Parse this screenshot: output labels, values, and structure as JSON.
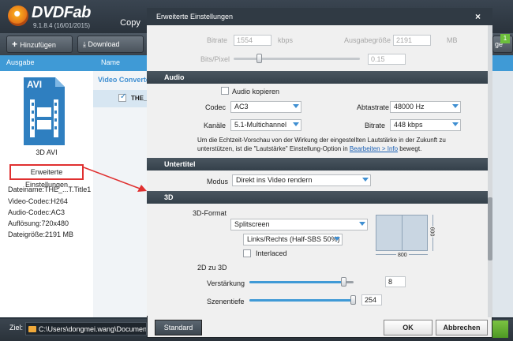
{
  "app": {
    "name": "DVDFab",
    "version": "9.1.8.4 (16/01/2015)",
    "tab": "Copy"
  },
  "toolbar": {
    "add": "Hinzufügen",
    "download": "Download",
    "right_partial": "ge",
    "badge": "1"
  },
  "columns": {
    "output": "Ausgabe",
    "name": "Name"
  },
  "main": {
    "converter": "Video Converter",
    "title_item": "THE_"
  },
  "left": {
    "format_badge": "AVI",
    "format_label": "3D AVI",
    "advanced_button": "Erweiterte Einstellungen",
    "info": [
      "Dateiname:THE_...T.Title1",
      "Video-Codec:H264",
      "Audio-Codec:AC3",
      "Auflösung:720x480",
      "Dateigröße:2191 MB"
    ]
  },
  "bottom": {
    "ziel_label": "Ziel:",
    "path": "C:\\Users\\dongmei.wang\\Documents\\D"
  },
  "dialog": {
    "title": "Erweiterte Einstellungen",
    "close": "×",
    "video": {
      "bitrate_label": "Bitrate",
      "bitrate_value": "1554",
      "bitrate_unit": "kbps",
      "size_label": "Ausgabegröße",
      "size_value": "2191",
      "size_unit": "MB",
      "bpp_label": "Bits/Pixel",
      "bpp_value": "0.15",
      "bpp_level": 0.2
    },
    "audio": {
      "section": "Audio",
      "copy_label": "Audio kopieren",
      "codec_label": "Codec",
      "codec_value": "AC3",
      "rate_label": "Abtastrate",
      "rate_value": "48000 Hz",
      "channels_label": "Kanäle",
      "channels_value": "5.1-Multichannel",
      "bitrate_label": "Bitrate",
      "bitrate_value": "448 kbps",
      "note1": "Um die Echtzeit-Vorschau von der Wirkung der eingestellten Lautstärke in der Zukunft zu",
      "note2a": "unterstützen, ist die \"Lautstärke\" Einstellung-Option in ",
      "note2_link": "Bearbeiten > Info",
      "note2b": " bewegt."
    },
    "subtitle": {
      "section": "Untertitel",
      "mode_label": "Modus",
      "mode_value": "Direkt ins Video rendern"
    },
    "three_d": {
      "section": "3D",
      "format_label": "3D-Format",
      "format_value": "Splitscreen",
      "layout_value": "Links/Rechts (Half-SBS 50%)",
      "interlaced_label": "Interlaced",
      "width_label": "800",
      "height_label": "600",
      "conv_label": "2D zu 3D",
      "gain_label": "Verstärkung",
      "gain_value": "8",
      "gain_level": 0.9,
      "depth_label": "Szenentiefe",
      "depth_value": "254",
      "depth_level": 0.99
    },
    "buttons": {
      "standard": "Standard",
      "ok": "OK",
      "cancel": "Abbrechen"
    }
  }
}
